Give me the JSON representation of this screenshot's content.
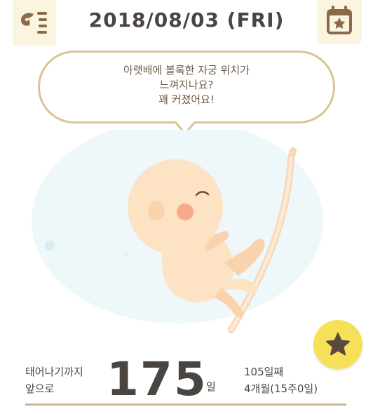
{
  "header": {
    "date_title": "2018/08/03 (FRI)",
    "menu_icon": "menu-list-icon",
    "calendar_icon": "calendar-star-icon"
  },
  "bubble": {
    "line1": "아랫배에 볼록한 자궁 위치가",
    "line2": "느껴지나요?",
    "line3": "꽤 커졌어요!"
  },
  "fab": {
    "icon": "star-icon"
  },
  "countdown": {
    "label_line1": "태어나기까지",
    "label_line2": "앞으로",
    "days_left": "175",
    "unit": "일"
  },
  "progress": {
    "day_count": "105일째",
    "month_week": "4개월(15주0일)"
  },
  "colors": {
    "accent_beige": "#fbf4df",
    "border_tan": "#d9c49a",
    "brown": "#8a6a4a",
    "fab_yellow": "#f6e05a",
    "text_dark": "#4a4540",
    "baby_skin": "#fde3c4",
    "womb_blue": "#eef7f9"
  }
}
